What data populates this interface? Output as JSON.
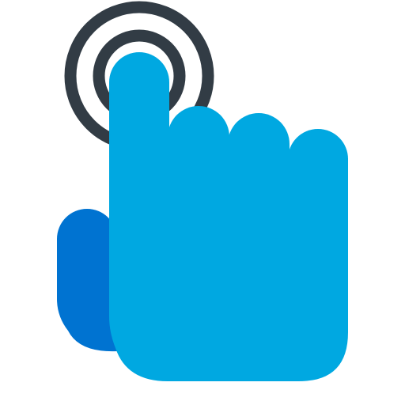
{
  "icon": {
    "name": "tap-gesture-icon",
    "colors": {
      "ring": "#323c45",
      "hand": "#00a8e1",
      "thumb": "#0073d1",
      "background": "#ffffff"
    }
  }
}
